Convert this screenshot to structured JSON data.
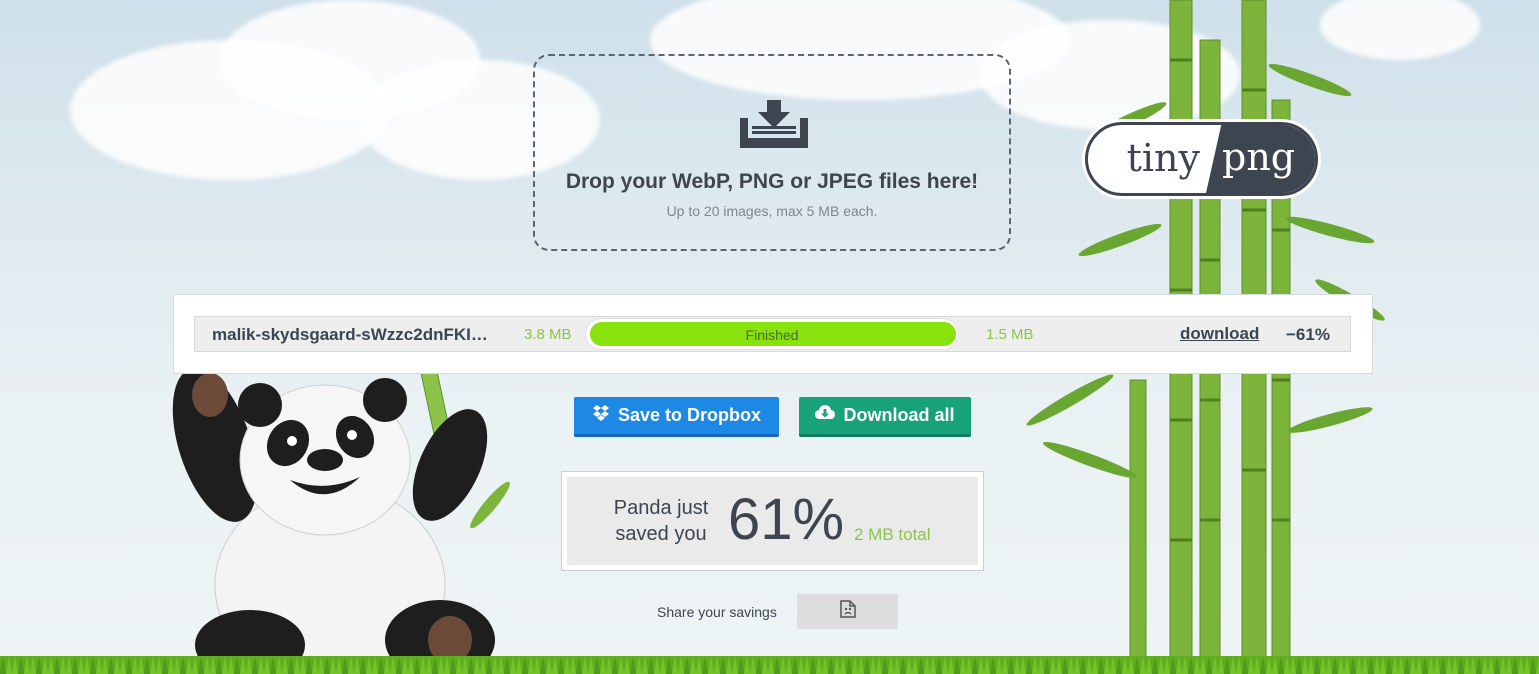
{
  "dropzone": {
    "icon": "download-tray-icon",
    "title": "Drop your WebP, PNG or JPEG files here!",
    "subtitle": "Up to 20 images, max 5 MB each."
  },
  "logo": {
    "left_text": "tiny",
    "right_text": "png"
  },
  "results": [
    {
      "filename": "malik-skydsgaard-sWzzc2dnFKI…",
      "original_size": "3.8 MB",
      "status": "Finished",
      "progress": 1.0,
      "new_size": "1.5 MB",
      "download_label": "download",
      "saving": "−61%"
    }
  ],
  "actions": {
    "dropbox_label": "Save to Dropbox",
    "dropbox_icon": "dropbox-icon",
    "download_all_label": "Download all",
    "download_all_icon": "cloud-download-icon"
  },
  "summary": {
    "line1": "Panda just",
    "line2": "saved you",
    "percent": "61%",
    "total": "2 MB total"
  },
  "share": {
    "label": "Share your savings",
    "icon": "broken-image-icon"
  },
  "colors": {
    "text_dark": "#3d4550",
    "green_text": "#8cc34a",
    "progress_fill": "#87e20d",
    "dropbox_blue": "#1e88e5",
    "download_green": "#17a27a"
  }
}
